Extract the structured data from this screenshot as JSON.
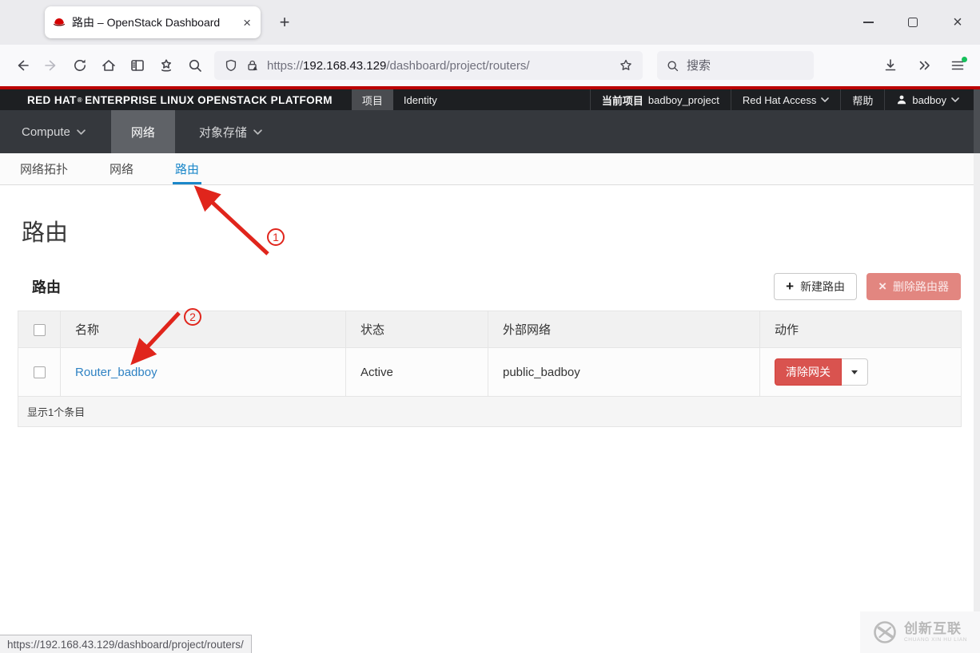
{
  "browser": {
    "tab_title": "路由 – OpenStack Dashboard",
    "url_scheme": "https://",
    "url_host": "192.168.43.129",
    "url_path": "/dashboard/project/routers/",
    "search_placeholder": "搜索",
    "status_url": "https://192.168.43.129/dashboard/project/routers/"
  },
  "header": {
    "brand_strong": "RED HAT",
    "brand_reg": "®",
    "brand_rest": "ENTERPRISE LINUX OPENSTACK PLATFORM",
    "tabs": [
      {
        "label": "项目"
      },
      {
        "label": "Identity"
      }
    ],
    "current_project_label": "当前项目",
    "current_project": "badboy_project",
    "redhat_access": "Red Hat Access",
    "help": "帮助",
    "user": "badboy"
  },
  "navbar": {
    "items": [
      {
        "label": "Compute"
      },
      {
        "label": "网络"
      },
      {
        "label": "对象存储"
      }
    ]
  },
  "subtabs": {
    "items": [
      {
        "label": "网络拓扑"
      },
      {
        "label": "网络"
      },
      {
        "label": "路由"
      }
    ]
  },
  "page": {
    "title": "路由",
    "section_title": "路由"
  },
  "actions": {
    "create_label": "新建路由",
    "delete_label": "删除路由器",
    "row_action_label": "清除网关"
  },
  "table": {
    "headers": [
      "名称",
      "状态",
      "外部网络",
      "动作"
    ],
    "rows": [
      {
        "name": "Router_badboy",
        "status": "Active",
        "external_network": "public_badboy"
      }
    ],
    "footer": "显示1个条目"
  },
  "annotations": {
    "step1": "1",
    "step2": "2"
  },
  "watermark": {
    "name": "创新互联",
    "subtitle": "CHUANG XIN HU LIAN"
  },
  "colors": {
    "accent_red": "#bb0000",
    "danger": "#d9534f",
    "link_blue": "#2f82c3",
    "tab_blue": "#1b87c9"
  }
}
